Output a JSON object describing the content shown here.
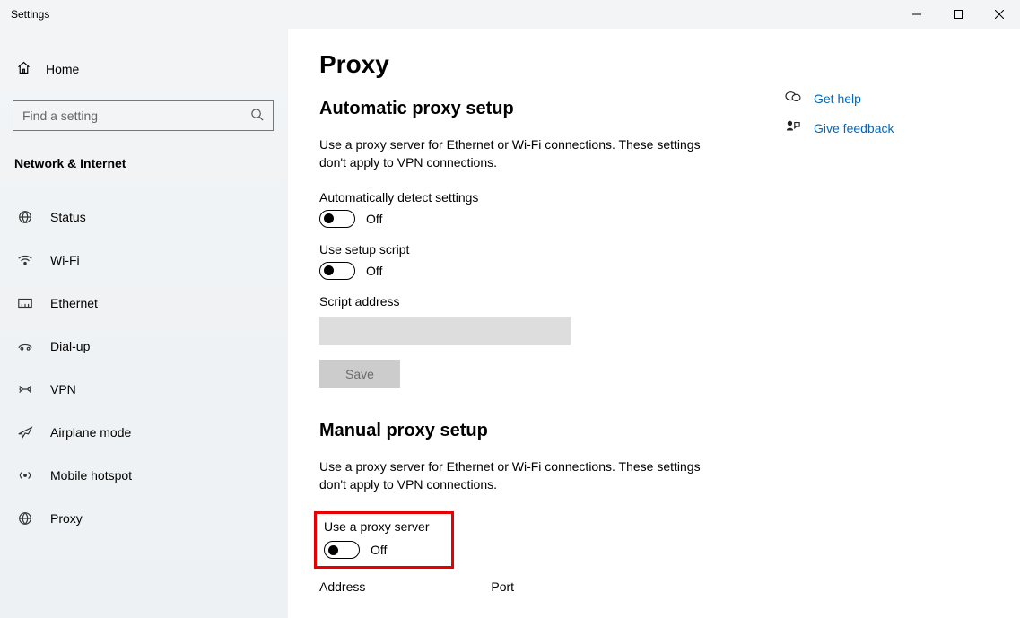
{
  "window": {
    "title": "Settings"
  },
  "sidebar": {
    "home_label": "Home",
    "search_placeholder": "Find a setting",
    "category": "Network & Internet",
    "items": [
      {
        "label": "Status"
      },
      {
        "label": "Wi-Fi"
      },
      {
        "label": "Ethernet"
      },
      {
        "label": "Dial-up"
      },
      {
        "label": "VPN"
      },
      {
        "label": "Airplane mode"
      },
      {
        "label": "Mobile hotspot"
      },
      {
        "label": "Proxy"
      }
    ]
  },
  "page": {
    "title": "Proxy",
    "section_auto": {
      "title": "Automatic proxy setup",
      "desc": "Use a proxy server for Ethernet or Wi-Fi connections. These settings don't apply to VPN connections.",
      "auto_detect_label": "Automatically detect settings",
      "auto_detect_state": "Off",
      "setup_script_label": "Use setup script",
      "setup_script_state": "Off",
      "script_address_label": "Script address",
      "script_address_value": "",
      "save_label": "Save"
    },
    "section_manual": {
      "title": "Manual proxy setup",
      "desc": "Use a proxy server for Ethernet or Wi-Fi connections. These settings don't apply to VPN connections.",
      "use_proxy_label": "Use a proxy server",
      "use_proxy_state": "Off",
      "address_label": "Address",
      "port_label": "Port"
    }
  },
  "rightlinks": {
    "help": "Get help",
    "feedback": "Give feedback"
  }
}
